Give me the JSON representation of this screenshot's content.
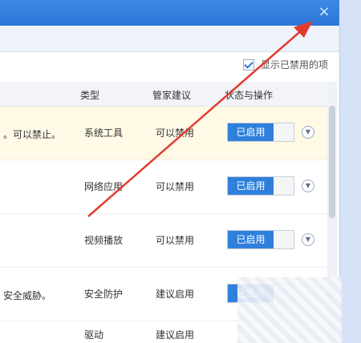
{
  "window": {
    "close_glyph": "×"
  },
  "filter": {
    "label": "显示已禁用的项",
    "checked": true
  },
  "table": {
    "headers": {
      "type": "类型",
      "recommend": "管家建议",
      "status": "状态与操作"
    },
    "rows": [
      {
        "desc": "。可以禁止。",
        "type": "系统工具",
        "recommend": "可以禁用",
        "status": "已启用"
      },
      {
        "desc": "",
        "type": "网络应用",
        "recommend": "可以禁用",
        "status": "已启用"
      },
      {
        "desc": "",
        "type": "视频播放",
        "recommend": "可以禁用",
        "status": "已启用"
      },
      {
        "desc": "安全威胁。",
        "type": "安全防护",
        "recommend": "建议启用",
        "status": "已启用"
      },
      {
        "desc": "",
        "type": "驱动 ",
        "recommend": "建议启用",
        "status": ""
      }
    ]
  },
  "colors": {
    "accent": "#2f80db",
    "annotation_arrow": "#e23b2e",
    "highlight_row": "#fff9e6"
  }
}
